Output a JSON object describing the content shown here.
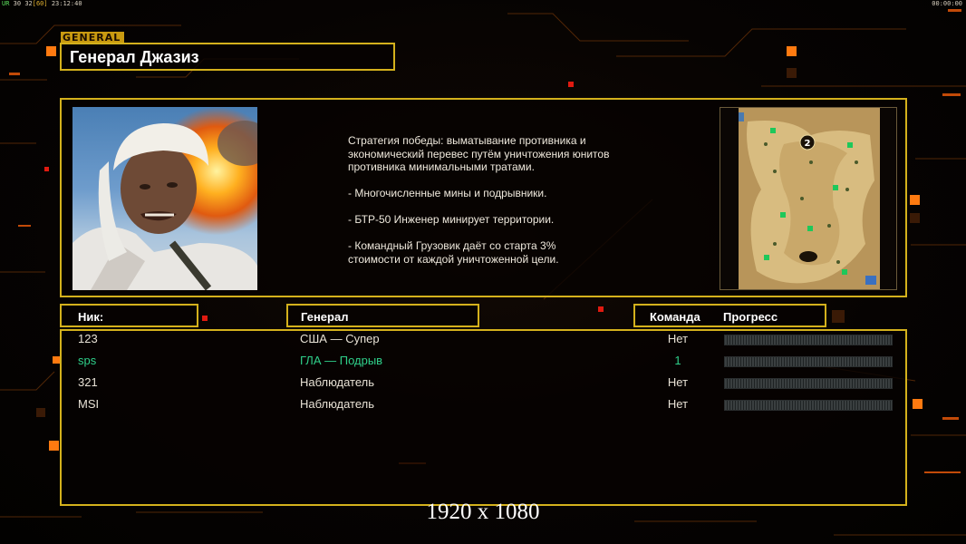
{
  "hud": {
    "fps_label": "UR",
    "fps_a": "30",
    "fps_b": "32",
    "fps_c": "[60]",
    "time": "23:12:40",
    "clock": "00:00:00"
  },
  "general": {
    "tag": "GENERAL",
    "name": "Генерал Джазиз",
    "description": [
      "Стратегия победы: выматывание противника и\n экономический перевес путём уничтожения юнитов\n противника минимальными тратами.",
      "- Многочисленные мины и подрывники.",
      "- БТР-50 Инженер минирует территории.",
      "- Командный Грузовик даёт со старта 3%\n стоимости от каждой уничтоженной цели."
    ]
  },
  "table": {
    "headers": {
      "nick": "Ник:",
      "general": "Генерал",
      "team": "Команда",
      "progress": "Прогресс"
    },
    "rows": [
      {
        "nick": "123",
        "general": "США — Супер",
        "team": "Нет",
        "progress": 0
      },
      {
        "nick": "sps",
        "general": "ГЛА — Подрыв",
        "team": "1",
        "progress": 0
      },
      {
        "nick": "321",
        "general": "Наблюдатель",
        "team": "Нет",
        "progress": 0
      },
      {
        "nick": "MSI",
        "general": "Наблюдатель",
        "team": "Нет",
        "progress": 0
      }
    ]
  },
  "minimap": {
    "start_marker": "2"
  },
  "watermark": "1920 x 1080",
  "colors": {
    "frame": "#d4b11c",
    "accent": "#ff7a10",
    "highlight_player": "#2fd08a"
  }
}
